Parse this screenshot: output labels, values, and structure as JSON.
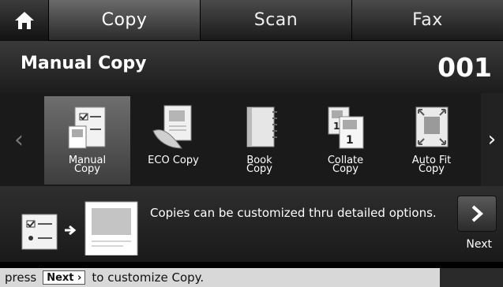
{
  "tabs": [
    {
      "label": "Copy",
      "active": true
    },
    {
      "label": "Scan",
      "active": false
    },
    {
      "label": "Fax",
      "active": false
    }
  ],
  "header": {
    "title": "Manual Copy",
    "count": "001"
  },
  "carousel": {
    "items": [
      {
        "label_line1": "Manual",
        "label_line2": "Copy",
        "icon": "manual-copy-icon",
        "selected": true
      },
      {
        "label_line1": "ECO Copy",
        "label_line2": "",
        "icon": "eco-copy-icon",
        "selected": false
      },
      {
        "label_line1": "Book",
        "label_line2": "Copy",
        "icon": "book-copy-icon",
        "selected": false
      },
      {
        "label_line1": "Collate",
        "label_line2": "Copy",
        "icon": "collate-copy-icon",
        "selected": false
      },
      {
        "label_line1": "Auto Fit",
        "label_line2": "Copy",
        "icon": "auto-fit-copy-icon",
        "selected": false
      }
    ]
  },
  "description": {
    "text": "Copies can be customized thru detailed options."
  },
  "next": {
    "label": "Next"
  },
  "hint": {
    "prefix": "press",
    "key": "Next",
    "suffix": "to  customize Copy."
  },
  "colors": {
    "background": "#000000",
    "selected_item": "#5a5a5a",
    "hint_bar": "#d8d8d8"
  }
}
